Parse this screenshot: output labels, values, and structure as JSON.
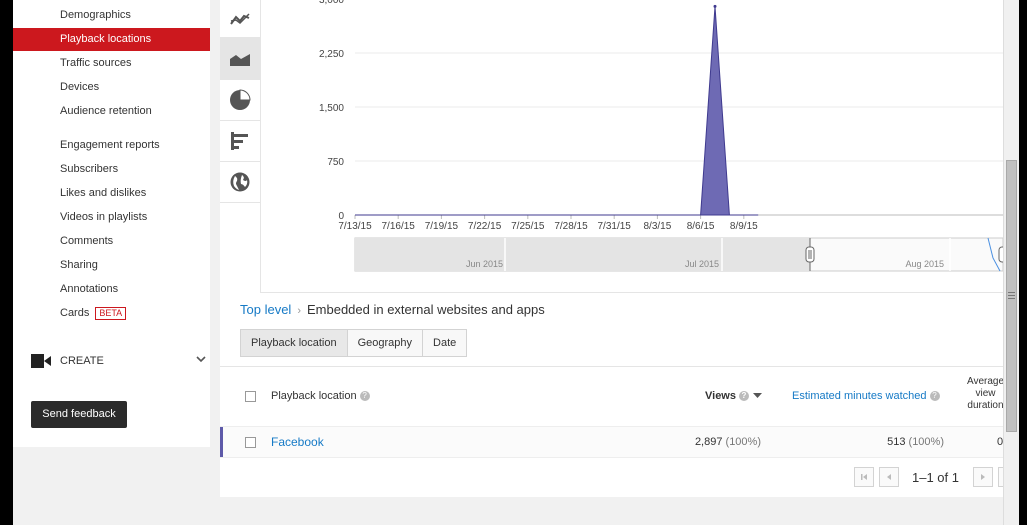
{
  "sidebar": {
    "items": [
      {
        "label": "Demographics",
        "active": false
      },
      {
        "label": "Playback locations",
        "active": true
      },
      {
        "label": "Traffic sources",
        "active": false
      },
      {
        "label": "Devices",
        "active": false
      },
      {
        "label": "Audience retention",
        "active": false
      },
      {
        "label": "Engagement reports",
        "active": false
      },
      {
        "label": "Subscribers",
        "active": false
      },
      {
        "label": "Likes and dislikes",
        "active": false
      },
      {
        "label": "Videos in playlists",
        "active": false
      },
      {
        "label": "Comments",
        "active": false
      },
      {
        "label": "Sharing",
        "active": false
      },
      {
        "label": "Annotations",
        "active": false
      },
      {
        "label": "Cards",
        "badge": "BETA",
        "active": false
      }
    ],
    "create_label": "CREATE",
    "feedback_label": "Send feedback"
  },
  "toolbar": {
    "icons": [
      "line-chart-icon",
      "area-chart-icon",
      "pie-chart-icon",
      "bar-chart-icon",
      "globe-icon"
    ]
  },
  "chart_data": {
    "type": "area",
    "x": [
      "7/13/15",
      "7/14/15",
      "7/15/15",
      "7/16/15",
      "7/17/15",
      "7/18/15",
      "7/19/15",
      "7/20/15",
      "7/21/15",
      "7/22/15",
      "7/23/15",
      "7/24/15",
      "7/25/15",
      "7/26/15",
      "7/27/15",
      "7/28/15",
      "7/29/15",
      "7/30/15",
      "7/31/15",
      "8/1/15",
      "8/2/15",
      "8/3/15",
      "8/4/15",
      "8/5/15",
      "8/6/15",
      "8/7/15",
      "8/8/15",
      "8/9/15",
      "8/10/15"
    ],
    "x_ticks": [
      "7/13/15",
      "7/16/15",
      "7/19/15",
      "7/22/15",
      "7/25/15",
      "7/28/15",
      "7/31/15",
      "8/3/15",
      "8/6/15",
      "8/9/15"
    ],
    "y_ticks": [
      "0",
      "750",
      "1,500",
      "2,250",
      "3,000"
    ],
    "ylim": [
      0,
      3000
    ],
    "series": [
      {
        "values": [
          0,
          0,
          0,
          0,
          0,
          0,
          0,
          0,
          0,
          0,
          0,
          0,
          0,
          0,
          0,
          0,
          0,
          0,
          0,
          0,
          0,
          0,
          0,
          0,
          0,
          2897,
          0,
          0,
          0
        ]
      }
    ],
    "colors": {
      "fill": "#6e6ab4",
      "stroke": "#3f3a8f"
    },
    "grid": true,
    "range_labels": [
      "Jun 2015",
      "Jul 2015",
      "Aug 2015"
    ]
  },
  "breadcrumb": {
    "root": "Top level",
    "current": "Embedded in external websites and apps"
  },
  "tabs": [
    "Playback location",
    "Geography",
    "Date"
  ],
  "table": {
    "headers": {
      "location": "Playback location",
      "views": "Views",
      "minutes": "Estimated minutes watched",
      "avg_duration": [
        "Average",
        "view",
        "duration"
      ]
    },
    "rows": [
      {
        "location": "Facebook",
        "views": "2,897",
        "views_pct": "(100%)",
        "minutes": "513",
        "minutes_pct": "(100%)",
        "avg_duration": "0"
      }
    ]
  },
  "pager": {
    "range": "1–1 of 1"
  },
  "colors": {
    "accent": "#cc181e",
    "link": "#167ac6"
  }
}
